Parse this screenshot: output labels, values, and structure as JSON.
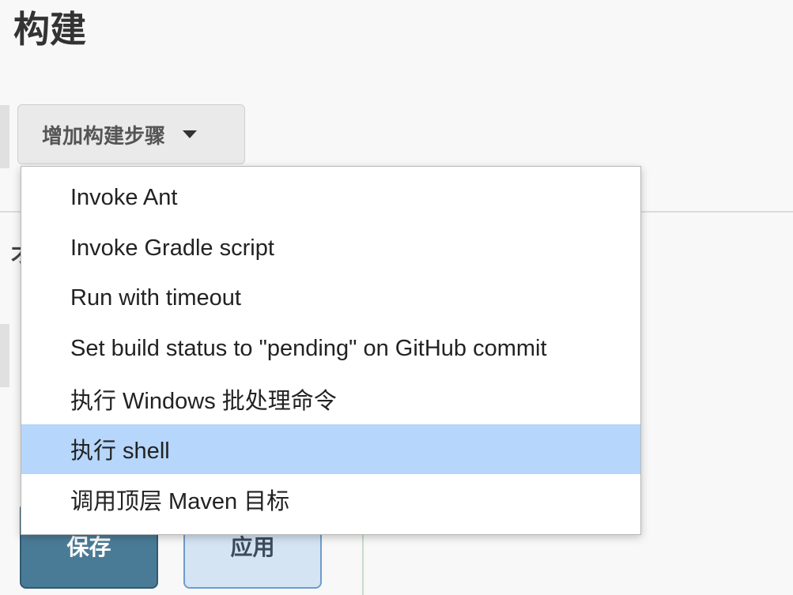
{
  "section": {
    "title": "构建",
    "partial_heading_glyph": "才"
  },
  "add_step_button": {
    "label": "增加构建步骤"
  },
  "dropdown": {
    "items": [
      {
        "label": "Invoke Ant",
        "selected": false
      },
      {
        "label": "Invoke Gradle script",
        "selected": false
      },
      {
        "label": "Run with timeout",
        "selected": false
      },
      {
        "label": "Set build status to \"pending\" on GitHub commit",
        "selected": false
      },
      {
        "label": "执行 Windows 批处理命令",
        "selected": false
      },
      {
        "label": "执行 shell",
        "selected": true
      },
      {
        "label": "调用顶层 Maven 目标",
        "selected": false
      }
    ],
    "highlight_color": "#b6d6fb"
  },
  "footer": {
    "save_label": "保存",
    "apply_label": "应用"
  },
  "colors": {
    "save_button_bg": "#4a7b96",
    "apply_button_bg": "#d4e4f3"
  }
}
